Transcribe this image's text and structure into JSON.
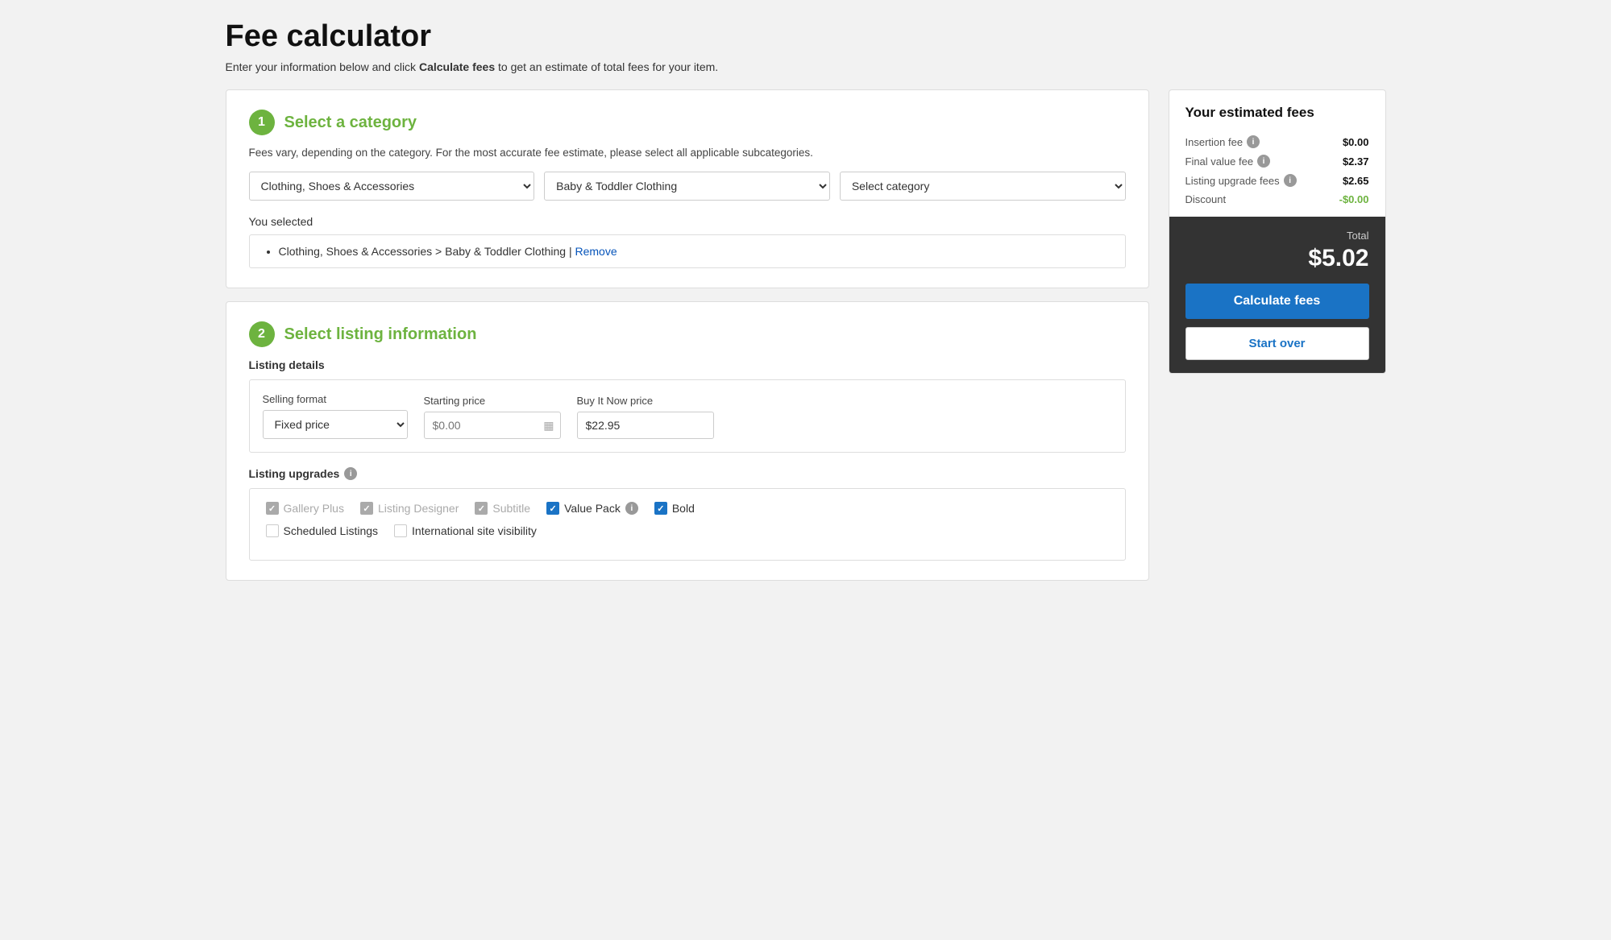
{
  "page": {
    "title": "Fee calculator",
    "subtitle_plain": "Enter your information below and click ",
    "subtitle_bold": "Calculate fees",
    "subtitle_after": " to get an estimate of total fees for your item."
  },
  "section1": {
    "step": "1",
    "title": "Select a category",
    "description": "Fees vary, depending on the category. For the most accurate fee estimate, please select all applicable subcategories.",
    "dropdown1_value": "Clothing, Shoes & Accessories",
    "dropdown2_value": "Baby & Toddler Clothing",
    "dropdown3_placeholder": "Select category",
    "you_selected_label": "You selected",
    "selected_path": "Clothing, Shoes & Accessories > Baby & Toddler Clothing",
    "remove_label": "Remove"
  },
  "section2": {
    "step": "2",
    "title": "Select listing information",
    "listing_details_label": "Listing details",
    "selling_format_label": "Selling format",
    "selling_format_value": "Fixed price",
    "starting_price_label": "Starting price",
    "starting_price_placeholder": "$0.00",
    "buy_now_label": "Buy It Now price",
    "buy_now_value": "$22.95",
    "listing_upgrades_label": "Listing upgrades",
    "upgrades": [
      {
        "label": "Gallery Plus",
        "checked": "gray",
        "disabled": true
      },
      {
        "label": "Listing Designer",
        "checked": "gray",
        "disabled": true
      },
      {
        "label": "Subtitle",
        "checked": "gray",
        "disabled": true
      },
      {
        "label": "Value Pack",
        "checked": "blue",
        "disabled": false,
        "has_info": true
      },
      {
        "label": "Bold",
        "checked": "blue",
        "disabled": false
      }
    ],
    "upgrades_row2": [
      {
        "label": "Scheduled Listings",
        "checked": "unchecked",
        "disabled": false
      },
      {
        "label": "International site visibility",
        "checked": "unchecked",
        "disabled": false
      }
    ]
  },
  "fees": {
    "title": "Your estimated fees",
    "rows": [
      {
        "label": "Insertion fee",
        "value": "$0.00",
        "has_info": true,
        "discount": false
      },
      {
        "label": "Final value fee",
        "value": "$2.37",
        "has_info": true,
        "discount": false
      },
      {
        "label": "Listing upgrade fees",
        "value": "$2.65",
        "has_info": true,
        "discount": false
      },
      {
        "label": "Discount",
        "value": "-$0.00",
        "has_info": false,
        "discount": true
      }
    ],
    "total_label": "Total",
    "total_amount": "$5.02",
    "calculate_btn_label": "Calculate fees",
    "start_over_btn_label": "Start over"
  },
  "icons": {
    "info": "i",
    "checkmark": "✓",
    "calendar": "▦"
  }
}
